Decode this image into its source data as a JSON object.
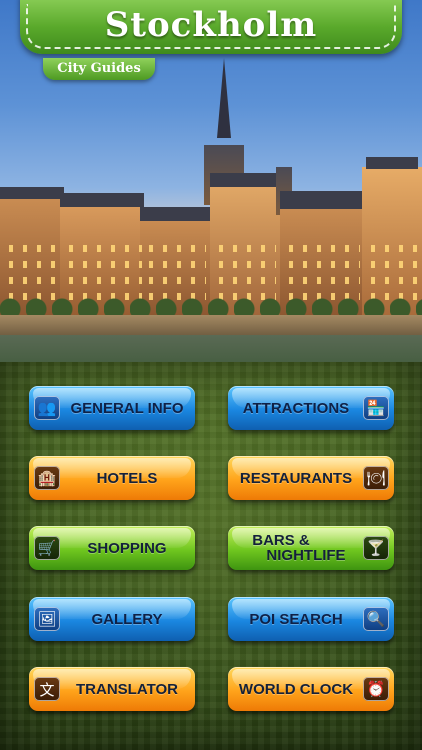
{
  "header": {
    "title": "Stockholm",
    "subtitle": "City Guides"
  },
  "menu": [
    {
      "label": "GENERAL INFO",
      "icon": "people-icon",
      "glyph": "👥"
    },
    {
      "label": "ATTRACTIONS",
      "icon": "store-icon",
      "glyph": "🏪"
    },
    {
      "label": "HOTELS",
      "icon": "hotel-building-icon",
      "glyph": "🏨"
    },
    {
      "label": "RESTAURANTS",
      "icon": "plate-cutlery-icon",
      "glyph": "🍽"
    },
    {
      "label": "SHOPPING",
      "icon": "shopping-cart-icon",
      "glyph": "🛒"
    },
    {
      "label_line1": "BARS &",
      "label_line2": "NIGHTLIFE",
      "icon": "cocktail-glass-icon",
      "glyph": "🍸"
    },
    {
      "label": "GALLERY",
      "icon": "photos-icon",
      "glyph": "🖼"
    },
    {
      "label": "POI SEARCH",
      "icon": "magnifier-icon",
      "glyph": "🔍"
    },
    {
      "label": "TRANSLATOR",
      "icon": "translate-icon",
      "glyph": "文"
    },
    {
      "label": "WORLD CLOCK",
      "icon": "alarm-clock-icon",
      "glyph": "⏰"
    }
  ],
  "colors": {
    "blue": "#1a86e0",
    "orange": "#ffa31a",
    "green": "#6fc61f",
    "banner": "#5aa92b"
  }
}
